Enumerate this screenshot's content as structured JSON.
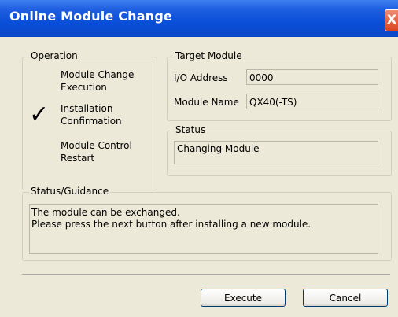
{
  "window": {
    "title": "Online Module Change",
    "close_symbol": "X"
  },
  "operation": {
    "legend": "Operation",
    "steps": [
      {
        "label": "Module Change\nExecution"
      },
      {
        "label": "Installation\nConfirmation",
        "checked": true
      },
      {
        "label": "Module Control\nRestart"
      }
    ],
    "check_mark": "✓"
  },
  "target_module": {
    "legend": "Target Module",
    "io_address_label": "I/O Address",
    "io_address_value": "0000",
    "module_name_label": "Module Name",
    "module_name_value": "QX40(-TS)"
  },
  "status": {
    "legend": "Status",
    "value": "Changing Module"
  },
  "guidance": {
    "legend": "Status/Guidance",
    "text": "The module can be exchanged.\nPlease press the next button after installing a new module."
  },
  "buttons": {
    "execute": "Execute",
    "cancel": "Cancel"
  },
  "colors": {
    "title_bar": "#0a4fd8",
    "dialog_bg": "#ece9d8",
    "close_button": "#d9451f"
  }
}
